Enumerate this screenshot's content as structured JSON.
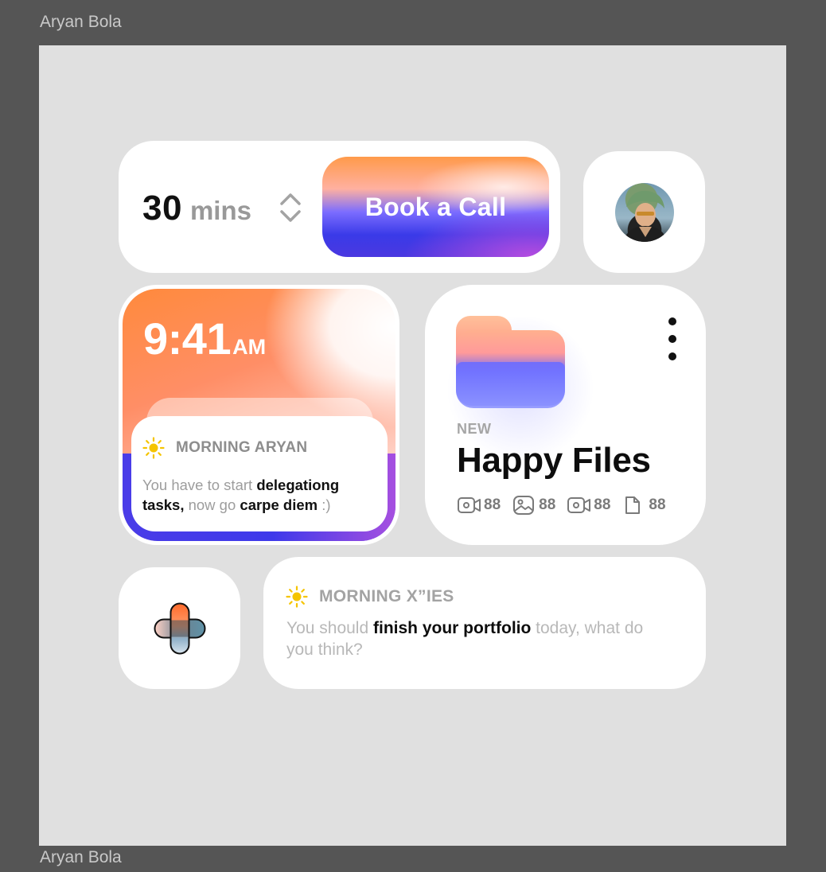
{
  "frame": {
    "label_top": "Aryan Bola",
    "label_bottom": "Aryan Bola"
  },
  "booking": {
    "duration_value": "30",
    "duration_unit": "mins",
    "stepper_icon": "chevron-up-down-icon",
    "cta_label": "Book a Call"
  },
  "profile": {
    "avatar_icon": "avatar"
  },
  "clock": {
    "time": "9:41",
    "ampm": "AM",
    "message": {
      "icon": "sun-icon",
      "title": "MORNING ARYAN",
      "body_1": "You have to start ",
      "body_2": "delegationg tasks,",
      "body_3": " now go ",
      "body_4": "carpe diem",
      "body_5": " :)"
    }
  },
  "files": {
    "badge": "NEW",
    "title": "Happy Files",
    "stats": [
      {
        "icon": "video-icon",
        "count": "88"
      },
      {
        "icon": "image-icon",
        "count": "88"
      },
      {
        "icon": "video-icon",
        "count": "88"
      },
      {
        "icon": "document-icon",
        "count": "88"
      }
    ]
  },
  "add": {
    "icon": "plus-icon"
  },
  "note": {
    "icon": "sun-icon",
    "title": "MORNING X”IES",
    "body_1": "You should ",
    "body_2": "finish your portfolio",
    "body_3": " today, what do you think?"
  },
  "colors": {
    "canvas": "#e0e0e0",
    "backdrop": "#555555",
    "sun": "#f5c400",
    "accent_orange": "#ff8a3c",
    "accent_blue": "#3a36e6",
    "accent_purple": "#b44ce0"
  }
}
